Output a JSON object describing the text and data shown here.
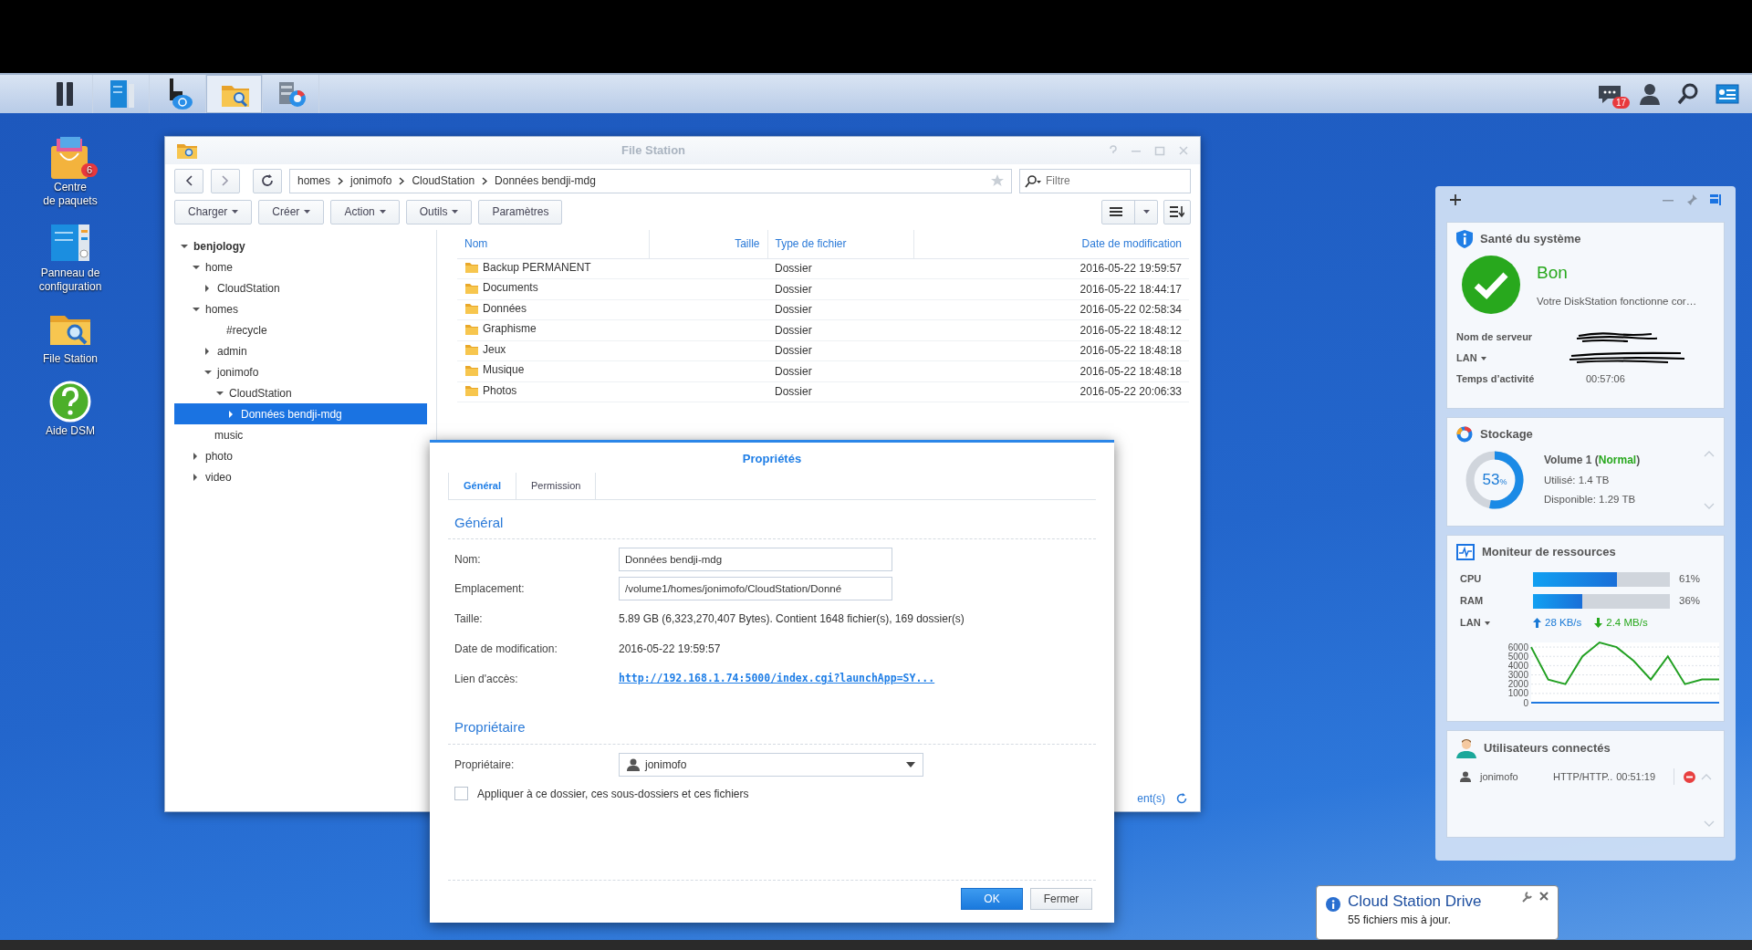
{
  "taskbar": {
    "apps": [
      {
        "kind": "main-menu",
        "active": false
      },
      {
        "kind": "control-panel",
        "active": false
      },
      {
        "kind": "cloud-sync",
        "active": false
      },
      {
        "kind": "file-station",
        "active": true
      },
      {
        "kind": "storage",
        "active": false
      }
    ],
    "notifications_badge": "17"
  },
  "desktop_icons": [
    {
      "kind": "package",
      "label": "Centre\nde paquets",
      "badge": "6"
    },
    {
      "kind": "control-panel",
      "label": "Panneau de\nconfiguration"
    },
    {
      "kind": "file-station",
      "label": "File Station"
    },
    {
      "kind": "help",
      "label": "Aide DSM"
    }
  ],
  "file_station": {
    "title": "File Station",
    "path": [
      "homes",
      "jonimofo",
      "CloudStation",
      "Données bendji-mdg"
    ],
    "search": {
      "placeholder": "Filtre"
    },
    "toolbar": [
      {
        "label": "Charger",
        "dropdown": true
      },
      {
        "label": "Créer",
        "dropdown": true
      },
      {
        "label": "Action",
        "dropdown": true
      },
      {
        "label": "Outils",
        "dropdown": true
      },
      {
        "label": "Paramètres",
        "dropdown": false
      }
    ],
    "tree": [
      {
        "label": "benjology",
        "expanded": true,
        "selected": false,
        "children": [
          {
            "label": "home",
            "expanded": true,
            "selected": false,
            "children": [
              {
                "label": "CloudStation",
                "expanded": false,
                "selected": false
              }
            ]
          },
          {
            "label": "homes",
            "expanded": true,
            "selected": false,
            "children": [
              {
                "label": "#recycle",
                "selected": false
              },
              {
                "label": "admin",
                "expanded": false,
                "selected": false
              },
              {
                "label": "jonimofo",
                "expanded": true,
                "selected": false,
                "children": [
                  {
                    "label": "CloudStation",
                    "expanded": true,
                    "selected": false,
                    "children": [
                      {
                        "label": "Données bendji-mdg",
                        "expanded": false,
                        "selected": true
                      }
                    ]
                  }
                ]
              }
            ]
          },
          {
            "label": "music",
            "selected": false
          },
          {
            "label": "photo",
            "expanded": false,
            "selected": false
          },
          {
            "label": "video",
            "expanded": false,
            "selected": false
          }
        ]
      }
    ],
    "table": {
      "columns": [
        "Nom",
        "Taille",
        "Type de fichier",
        "Date de modification"
      ],
      "rows": [
        {
          "name": "Backup PERMANENT",
          "type": "Dossier",
          "modified": "2016-05-22 19:59:57"
        },
        {
          "name": "Documents",
          "type": "Dossier",
          "modified": "2016-05-22 18:44:17"
        },
        {
          "name": "Données",
          "type": "Dossier",
          "modified": "2016-05-22 02:58:34"
        },
        {
          "name": "Graphisme",
          "type": "Dossier",
          "modified": "2016-05-22 18:48:12"
        },
        {
          "name": "Jeux",
          "type": "Dossier",
          "modified": "2016-05-22 18:48:18"
        },
        {
          "name": "Musique",
          "type": "Dossier",
          "modified": "2016-05-22 18:48:18"
        },
        {
          "name": "Photos",
          "type": "Dossier",
          "modified": "2016-05-22 20:06:33"
        }
      ]
    },
    "status_text": "ent(s)"
  },
  "properties": {
    "title": "Propriétés",
    "tabs": [
      {
        "label": "Général",
        "selected": true
      },
      {
        "label": "Permission",
        "selected": false
      }
    ],
    "general_heading": "Général",
    "fields": [
      {
        "kind": "input",
        "label": "Nom:",
        "value": "Données bendji-mdg"
      },
      {
        "kind": "input",
        "label": "Emplacement:",
        "value": "/volume1/homes/jonimofo/CloudStation/Donné"
      },
      {
        "kind": "text",
        "label": "Taille:",
        "value": "5.89 GB (6,323,270,407 Bytes). Contient 1648 fichier(s), 169 dossier(s)"
      },
      {
        "kind": "text",
        "label": "Date de modification:",
        "value": "2016-05-22 19:59:57"
      },
      {
        "kind": "link",
        "label": "Lien d'accès:",
        "value": "http://192.168.1.74:5000/index.cgi?launchApp=SY..."
      }
    ],
    "owner_heading": "Propriétaire",
    "owner_label": "Propriétaire:",
    "owner_value": "jonimofo",
    "apply_checkbox": {
      "label": "Appliquer à ce dossier, ces sous-dossiers et ces fichiers",
      "checked": false
    },
    "buttons": [
      {
        "label": "OK",
        "primary": true
      },
      {
        "label": "Fermer",
        "primary": false
      }
    ]
  },
  "widgets": {
    "health": {
      "title": "Santé du système",
      "status": "Bon",
      "message": "Votre DiskStation fonctionne cor…",
      "server_label": "Nom de serveur",
      "lan_label": "LAN",
      "uptime_label": "Temps d’activité",
      "uptime": "00:57:06"
    },
    "storage": {
      "title": "Stockage",
      "percent": "53",
      "percent_sign": "%",
      "level": 0.53,
      "volume": "Volume 1 (",
      "volume_status": "Normal",
      "volume_tail": ")",
      "used": "Utilisé: 1.4 TB",
      "available": "Disponible: 1.29 TB"
    },
    "monitor": {
      "title": "Moniteur de ressources",
      "meters": [
        {
          "name": "CPU",
          "level": 0.61,
          "reading": "61%"
        },
        {
          "name": "RAM",
          "level": 0.36,
          "reading": "36%"
        }
      ],
      "lan_label": "LAN",
      "upload": "28 KB/s",
      "download": "2.4 MB/s",
      "chart_data": {
        "type": "line",
        "grid": true,
        "ylim": [
          0,
          6500
        ],
        "yticks": [
          0,
          1000,
          2000,
          3000,
          4000,
          5000,
          6000
        ],
        "series": [
          {
            "color": "#22a022",
            "values": [
              6000,
              2500,
              2000,
              5000,
              6500,
              6000,
              4500,
              2500,
              5000,
              2000,
              2500,
              2500
            ]
          },
          {
            "color": "#1e78e0",
            "values": [
              0,
              0,
              0,
              0,
              0,
              0,
              0,
              0,
              0,
              0,
              0,
              0
            ]
          }
        ]
      }
    },
    "users": {
      "title": "Utilisateurs connectés",
      "rows": [
        {
          "user": "jonimofo",
          "protocol": "HTTP/HTTP..",
          "time": "00:51:19"
        }
      ]
    }
  },
  "notification": {
    "title": "Cloud Station Drive",
    "message": "55 fichiers mis à jour."
  }
}
